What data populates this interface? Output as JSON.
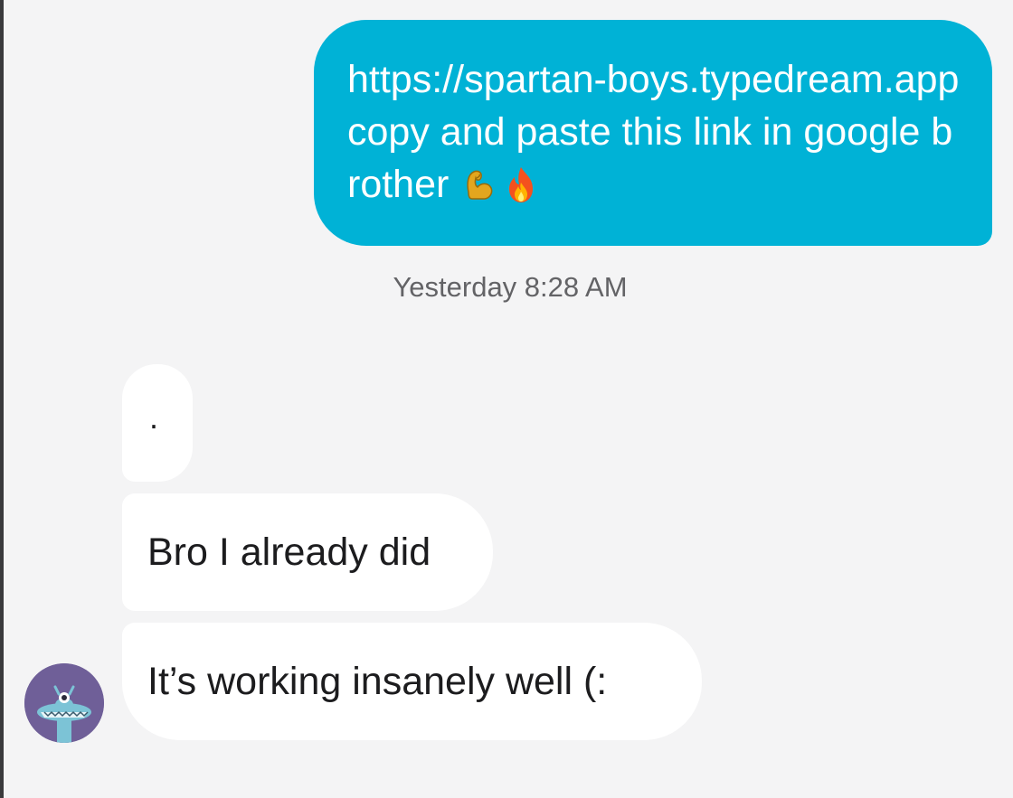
{
  "conversation": {
    "outgoing": [
      {
        "text": "https://spartan-boys.typedream.app copy and paste this link in google brother",
        "emojis": [
          "flexed-biceps-icon",
          "fire-icon"
        ]
      }
    ],
    "timestamp": "Yesterday 8:28 AM",
    "incoming": [
      {
        "text": "."
      },
      {
        "text": "Bro I already did"
      },
      {
        "text": "It’s working insanely well (:"
      }
    ],
    "avatar_icon": "monster-avatar-icon"
  },
  "colors": {
    "outgoing_bubble": "#00b2d6",
    "incoming_bubble": "#ffffff",
    "background": "#f4f4f5",
    "timestamp_text": "#636366",
    "avatar_bg": "#6f5f98"
  }
}
